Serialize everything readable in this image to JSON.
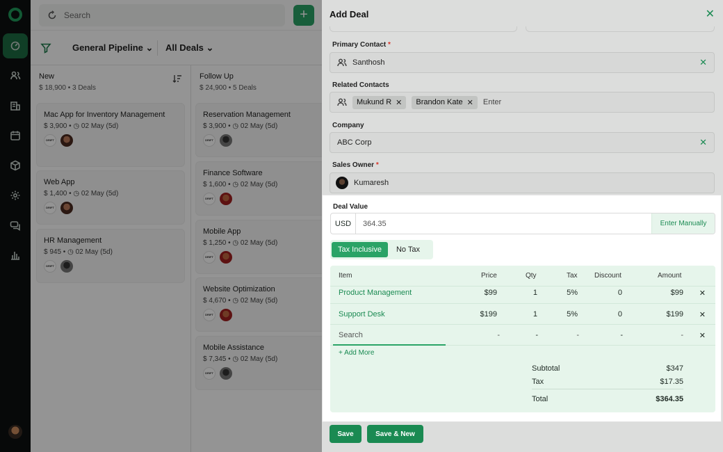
{
  "search": {
    "placeholder": "Search"
  },
  "toolbar": {
    "add": "+"
  },
  "board": {
    "pipeline": "General Pipeline",
    "view": "All Deals",
    "columns": [
      {
        "title": "New",
        "summary": "$ 18,900  •  3 Deals",
        "cards": [
          {
            "title": "Mac App for Inventory Management",
            "meta": "$ 3,900  •  ◷ 02 May (5d)"
          },
          {
            "title": "Web App",
            "meta": "$ 1,400  •  ◷ 02 May (5d)"
          },
          {
            "title": "HR Management",
            "meta": "$ 945  •  ◷ 02 May (5d)"
          }
        ]
      },
      {
        "title": "Follow Up",
        "summary": "$ 24,900  •  5 Deals",
        "cards": [
          {
            "title": "Reservation Management",
            "meta": "$ 3,900  •  ◷ 02 May (5d)"
          },
          {
            "title": "Finance Software",
            "meta": "$ 1,600  •  ◷ 02 May (5d)"
          },
          {
            "title": "Mobile App",
            "meta": "$ 1,250  •  ◷ 02 May (5d)"
          },
          {
            "title": "Website Optimization",
            "meta": "$ 4,670  •  ◷ 02 May (5d)"
          },
          {
            "title": "Mobile Assistance",
            "meta": "$ 7,345  •  ◷ 02 May (5d)"
          }
        ]
      }
    ],
    "badge": "DRIFT"
  },
  "panel": {
    "title": "Add Deal",
    "close": "✕",
    "primary_contact": {
      "label": "Primary Contact",
      "value": "Santhosh"
    },
    "related_contacts": {
      "label": "Related Contacts",
      "chips": [
        "Mukund R",
        "Brandon Kate"
      ],
      "placeholder": "Enter"
    },
    "company": {
      "label": "Company",
      "value": "ABC Corp"
    },
    "sales_owner": {
      "label": "Sales Owner",
      "value": "Kumaresh"
    },
    "required": "*",
    "remove": "✕",
    "deal_value": {
      "label": "Deal Value",
      "currency": "USD",
      "amount": "364.35",
      "manual": "Enter Manually"
    },
    "tax_toggle": {
      "on": "Tax Inclusive",
      "off": "No Tax"
    },
    "table": {
      "headers": [
        "Item",
        "Price",
        "Qty",
        "Tax",
        "Discount",
        "Amount"
      ],
      "rows": [
        {
          "item": "Product Management",
          "price": "$99",
          "qty": "1",
          "tax": "5%",
          "discount": "0",
          "amount": "$99"
        },
        {
          "item": "Support Desk",
          "price": "$199",
          "qty": "1",
          "tax": "5%",
          "discount": "0",
          "amount": "$199"
        }
      ],
      "search_row": {
        "item": "Search",
        "price": "-",
        "qty": "-",
        "tax": "-",
        "discount": "-",
        "amount": "-"
      },
      "add_more": "+ Add More",
      "subtotal_label": "Subtotal",
      "subtotal": "$347",
      "tax_label": "Tax",
      "tax": "$17.35",
      "total_label": "Total",
      "total": "$364.35"
    },
    "save": "Save",
    "save_new": "Save & New"
  },
  "colors": {
    "accent": "#2aa366",
    "accent_dark": "#1a8a52",
    "rail": "#0d1110"
  }
}
